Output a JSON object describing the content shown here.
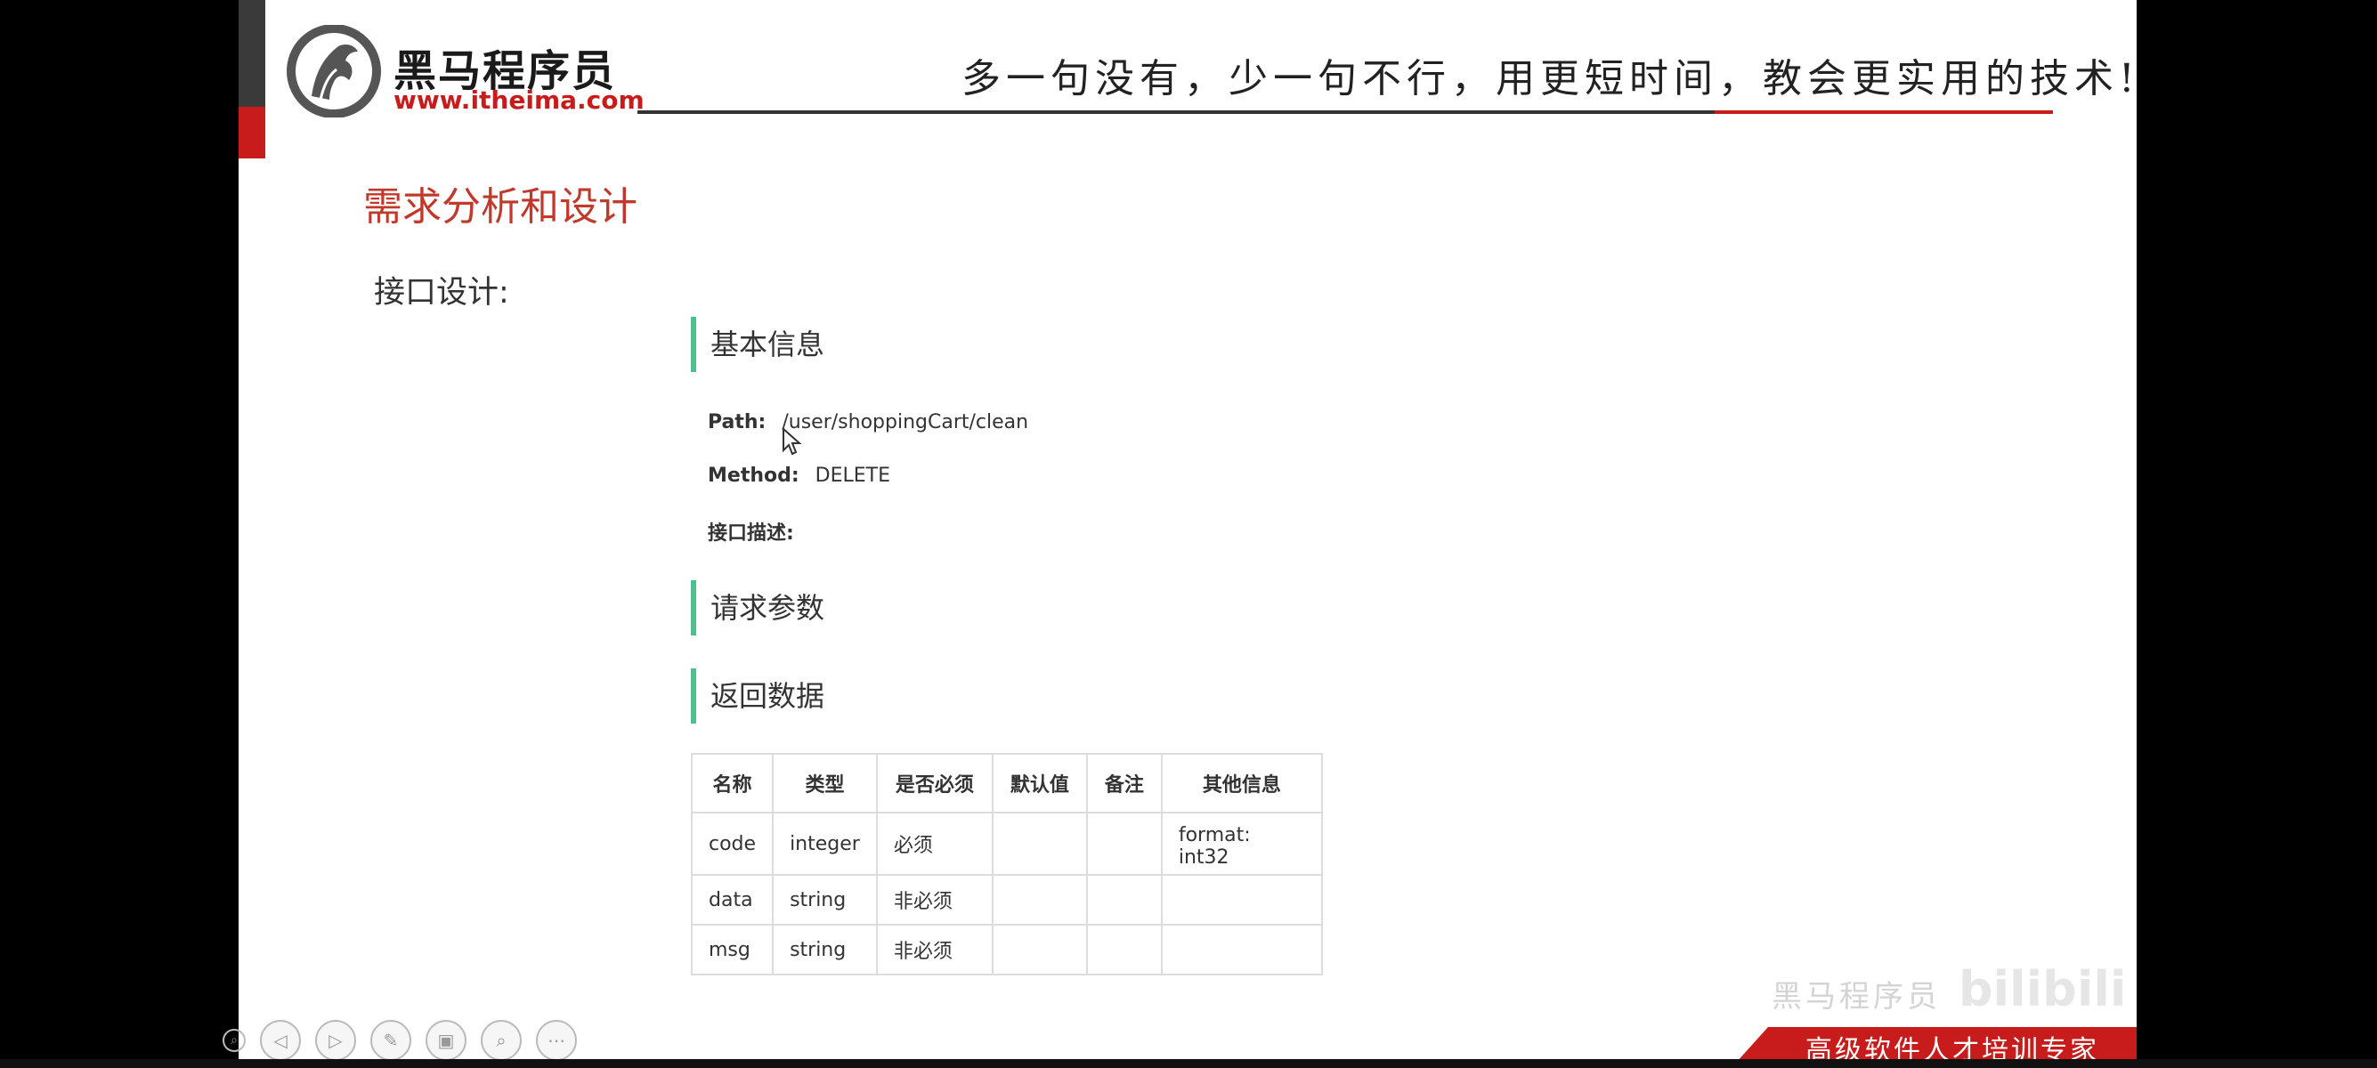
{
  "header": {
    "logo_name": "黑马程序员",
    "logo_url": "www.itheima.com",
    "slogan": "多一句没有，少一句不行，用更短时间，教会更实用的技术!"
  },
  "page_title": "需求分析和设计",
  "subtitle": "接口设计:",
  "sections": {
    "basic": "基本信息",
    "request": "请求参数",
    "response": "返回数据"
  },
  "basic_info": {
    "path_label": "Path:",
    "path_value": "/user/shoppingCart/clean",
    "method_label": "Method:",
    "method_value": "DELETE",
    "desc_label": "接口描述:"
  },
  "response_table": {
    "headers": [
      "名称",
      "类型",
      "是否必须",
      "默认值",
      "备注",
      "其他信息"
    ],
    "rows": [
      [
        "code",
        "integer",
        "必须",
        "",
        "",
        "format: int32"
      ],
      [
        "data",
        "string",
        "非必须",
        "",
        "",
        ""
      ],
      [
        "msg",
        "string",
        "非必须",
        "",
        "",
        ""
      ]
    ]
  },
  "footer": {
    "banner": "高级软件人才培训专家",
    "watermark": "黑马程序员",
    "bili": "bilibili"
  },
  "toolbar": {
    "icons": [
      "search-zoom-icon",
      "prev-icon",
      "next-icon",
      "pen-icon",
      "slides-icon",
      "zoom-icon",
      "more-icon"
    ]
  },
  "colors": {
    "brand_red": "#c81c1c",
    "title_red": "#c0392b",
    "section_bar": "#4fc08d"
  }
}
